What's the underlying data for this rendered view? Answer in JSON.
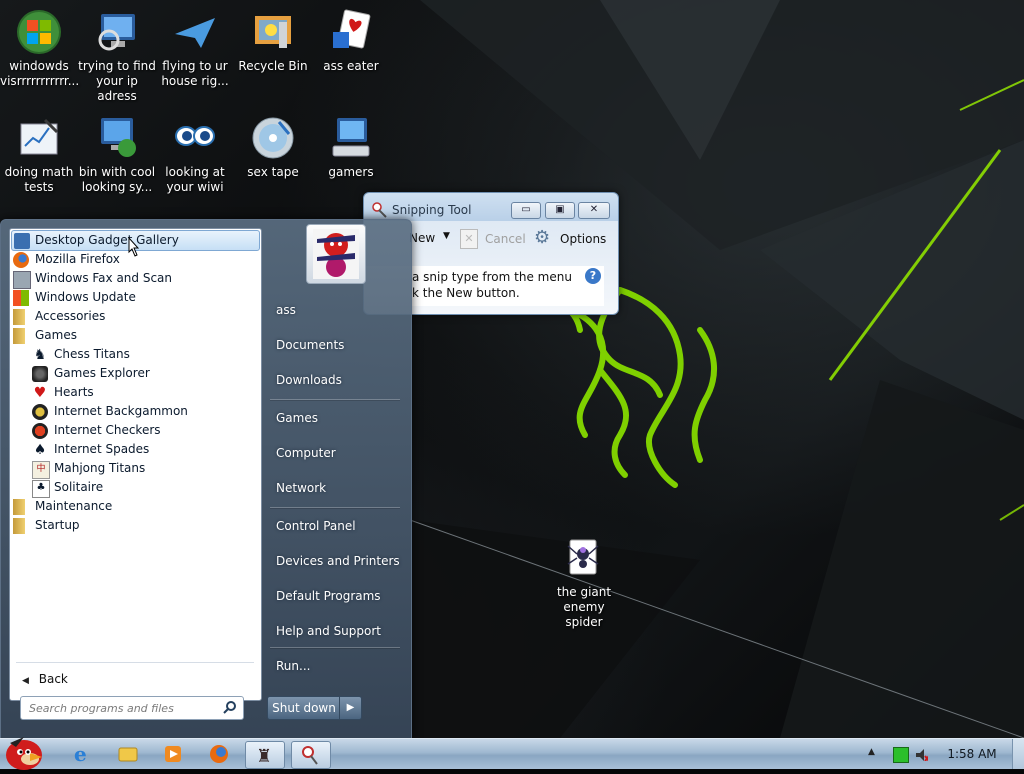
{
  "desktop": {
    "icons": [
      {
        "label": "windowds visrrrrrrrrrrr..."
      },
      {
        "label": "trying to find your ip adress"
      },
      {
        "label": "flying to ur house rig..."
      },
      {
        "label": "Recycle Bin"
      },
      {
        "label": "ass eater"
      },
      {
        "label": "doing math tests"
      },
      {
        "label": "bin with cool looking sy..."
      },
      {
        "label": "looking at your wiwi"
      },
      {
        "label": "sex tape"
      },
      {
        "label": "gamers"
      },
      {
        "label": "the giant enemy spider"
      }
    ]
  },
  "snipping_tool": {
    "title": "Snipping Tool",
    "new_label": "New",
    "cancel_label": "Cancel",
    "options_label": "Options",
    "message_line1": "a snip type from the menu",
    "message_line2": "k the New button."
  },
  "start_menu": {
    "programs": [
      {
        "label": "Desktop Gadget Gallery",
        "level": 0,
        "selected": true
      },
      {
        "label": "Mozilla Firefox",
        "level": 0
      },
      {
        "label": "Windows Fax and Scan",
        "level": 0
      },
      {
        "label": "Windows Update",
        "level": 0
      },
      {
        "label": "Accessories",
        "level": 0
      },
      {
        "label": "Games",
        "level": 0
      },
      {
        "label": "Chess Titans",
        "level": 1
      },
      {
        "label": "Games Explorer",
        "level": 1
      },
      {
        "label": "Hearts",
        "level": 1
      },
      {
        "label": "Internet Backgammon",
        "level": 1
      },
      {
        "label": "Internet Checkers",
        "level": 1
      },
      {
        "label": "Internet Spades",
        "level": 1
      },
      {
        "label": "Mahjong Titans",
        "level": 1
      },
      {
        "label": "Solitaire",
        "level": 1
      },
      {
        "label": "Maintenance",
        "level": 0
      },
      {
        "label": "Startup",
        "level": 0
      }
    ],
    "back_label": "Back",
    "search_placeholder": "Search programs and files",
    "right_items": [
      {
        "label": "ass"
      },
      {
        "label": "Documents"
      },
      {
        "label": "Downloads"
      },
      {
        "label": "Games"
      },
      {
        "label": "Computer"
      },
      {
        "label": "Network"
      },
      {
        "label": "Control Panel"
      },
      {
        "label": "Devices and Printers"
      },
      {
        "label": "Default Programs"
      },
      {
        "label": "Help and Support"
      },
      {
        "label": "Run..."
      }
    ],
    "shutdown_label": "Shut down"
  },
  "taskbar": {
    "clock": "1:58 AM"
  },
  "colors": {
    "razer_green": "#7fd000",
    "desktop_bg": "#0b0d0e",
    "taskbar": "#a9c0d7"
  }
}
